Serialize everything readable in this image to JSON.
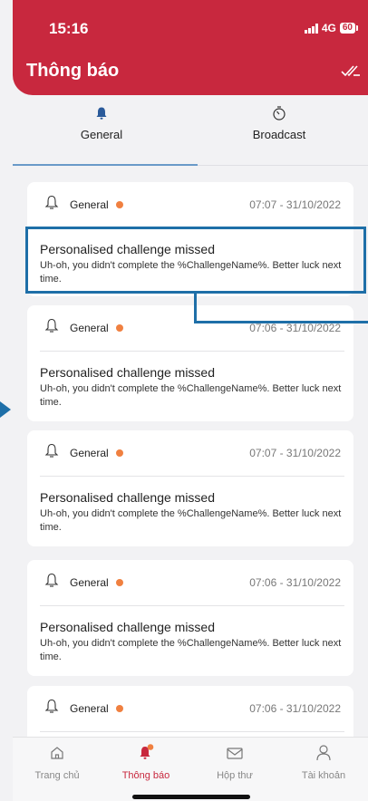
{
  "status_bar": {
    "time": "15:16",
    "network": "4G",
    "battery": "60"
  },
  "header": {
    "title": "Thông báo",
    "mark_read_icon": "double-check-icon"
  },
  "tabs": [
    {
      "label": "General",
      "icon": "bell-icon",
      "active": true
    },
    {
      "label": "Broadcast",
      "icon": "timer-icon",
      "active": false
    }
  ],
  "notifications": [
    {
      "category": "General",
      "time": "07:07 - 31/10/2022",
      "title": "Personalised challenge missed",
      "body": "Uh-oh, you didn't complete the %ChallengeName%. Better luck next time.",
      "unread": true
    },
    {
      "category": "General",
      "time": "07:06 - 31/10/2022",
      "title": "Personalised challenge missed",
      "body": "Uh-oh, you didn't complete the %ChallengeName%. Better luck next time.",
      "unread": true
    },
    {
      "category": "General",
      "time": "07:07 - 31/10/2022",
      "title": "Personalised challenge missed",
      "body": "Uh-oh, you didn't complete the %ChallengeName%. Better luck next time.",
      "unread": true
    },
    {
      "category": "General",
      "time": "07:06 - 31/10/2022",
      "title": "Personalised challenge missed",
      "body": "Uh-oh, you didn't complete the %ChallengeName%. Better luck next time.",
      "unread": true
    },
    {
      "category": "General",
      "time": "07:06 - 31/10/2022",
      "title": "",
      "body": "",
      "unread": true
    }
  ],
  "bottom_nav": [
    {
      "label": "Trang chủ",
      "icon": "home-icon",
      "active": false
    },
    {
      "label": "Thông báo",
      "icon": "bell-icon",
      "active": true
    },
    {
      "label": "Hộp thư",
      "icon": "mail-icon",
      "active": false
    },
    {
      "label": "Tài khoản",
      "icon": "user-icon",
      "active": false
    }
  ],
  "colors": {
    "brand": "#c8283e",
    "annotation": "#1e6fa8",
    "unread_dot": "#f08040"
  }
}
